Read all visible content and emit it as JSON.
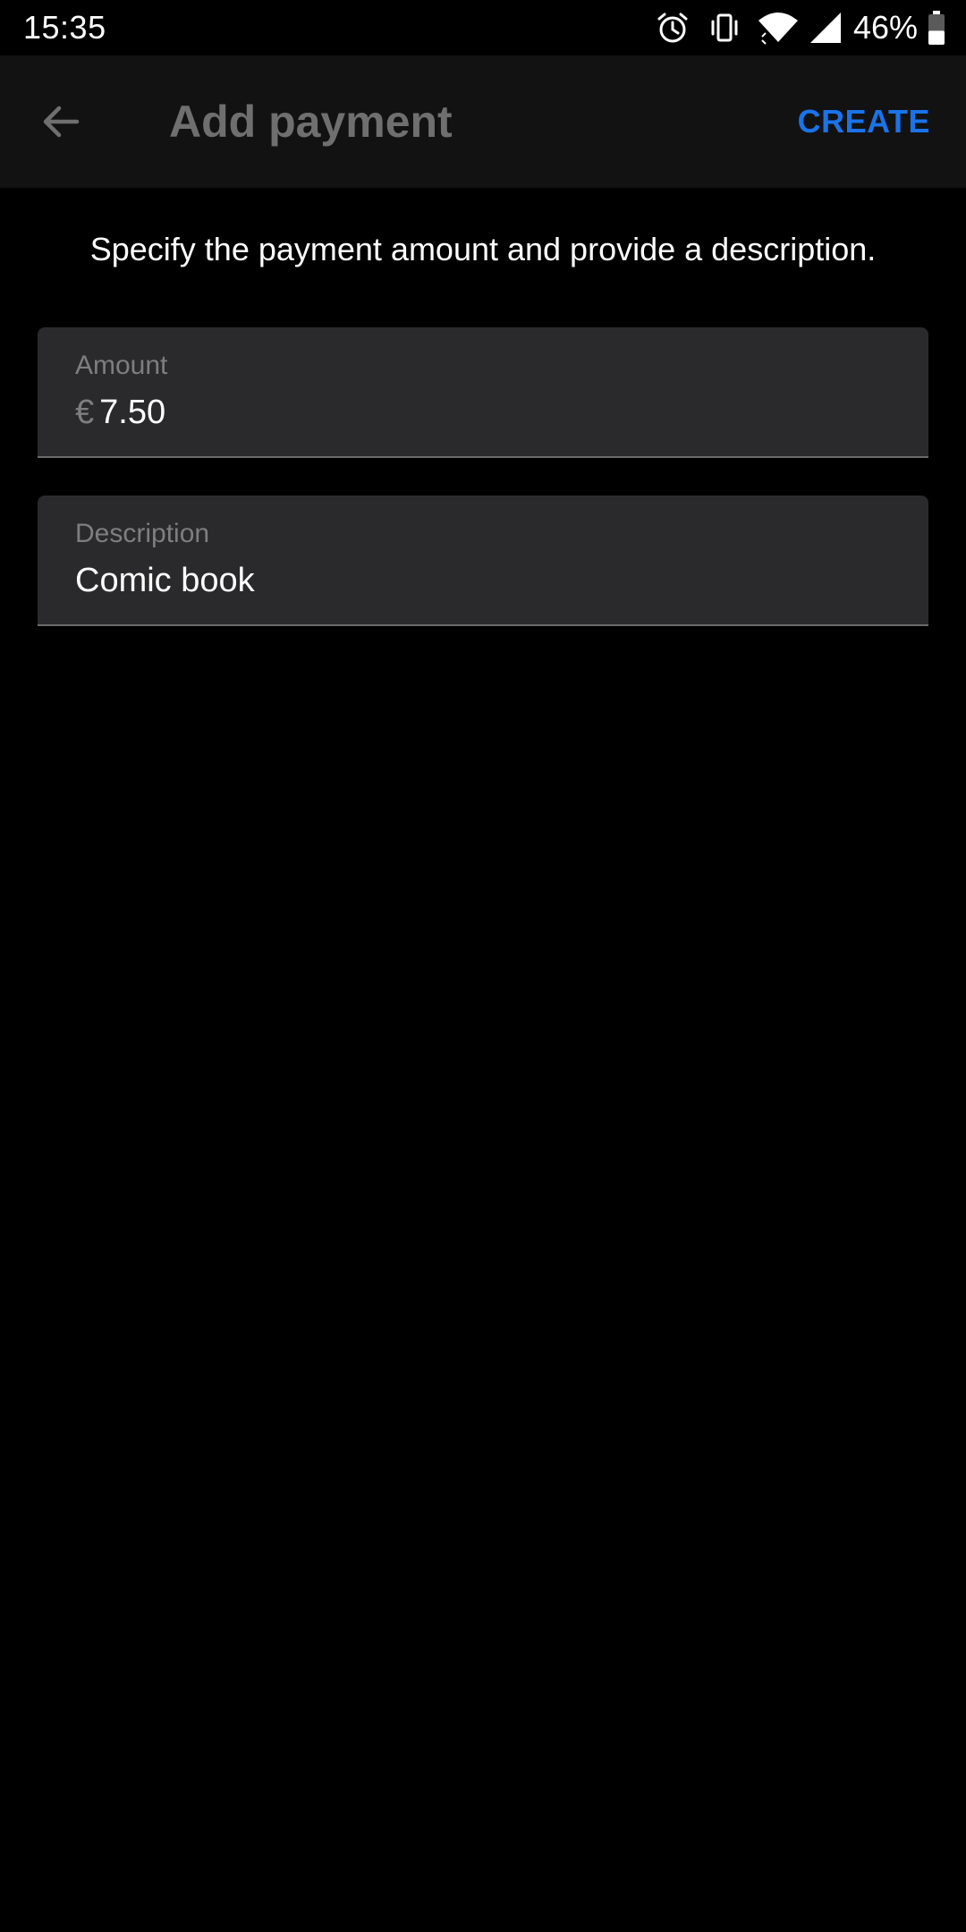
{
  "status_bar": {
    "time": "15:35",
    "battery_percent": "46%",
    "battery_level": 0.46,
    "icons": [
      "alarm-icon",
      "vibrate-icon",
      "wifi-icon",
      "cell-signal-icon",
      "battery-icon"
    ]
  },
  "app_bar": {
    "back_icon": "arrow-back-icon",
    "title": "Add payment",
    "action_label": "CREATE"
  },
  "content": {
    "instruction": "Specify the payment amount and provide a description."
  },
  "form": {
    "amount": {
      "label": "Amount",
      "currency": "€",
      "value": "7.50"
    },
    "description": {
      "label": "Description",
      "value": "Comic book"
    }
  },
  "colors": {
    "accent": "#1a73e8",
    "background": "#000000",
    "app_bar": "#121212",
    "field_background": "#2a2a2c"
  }
}
